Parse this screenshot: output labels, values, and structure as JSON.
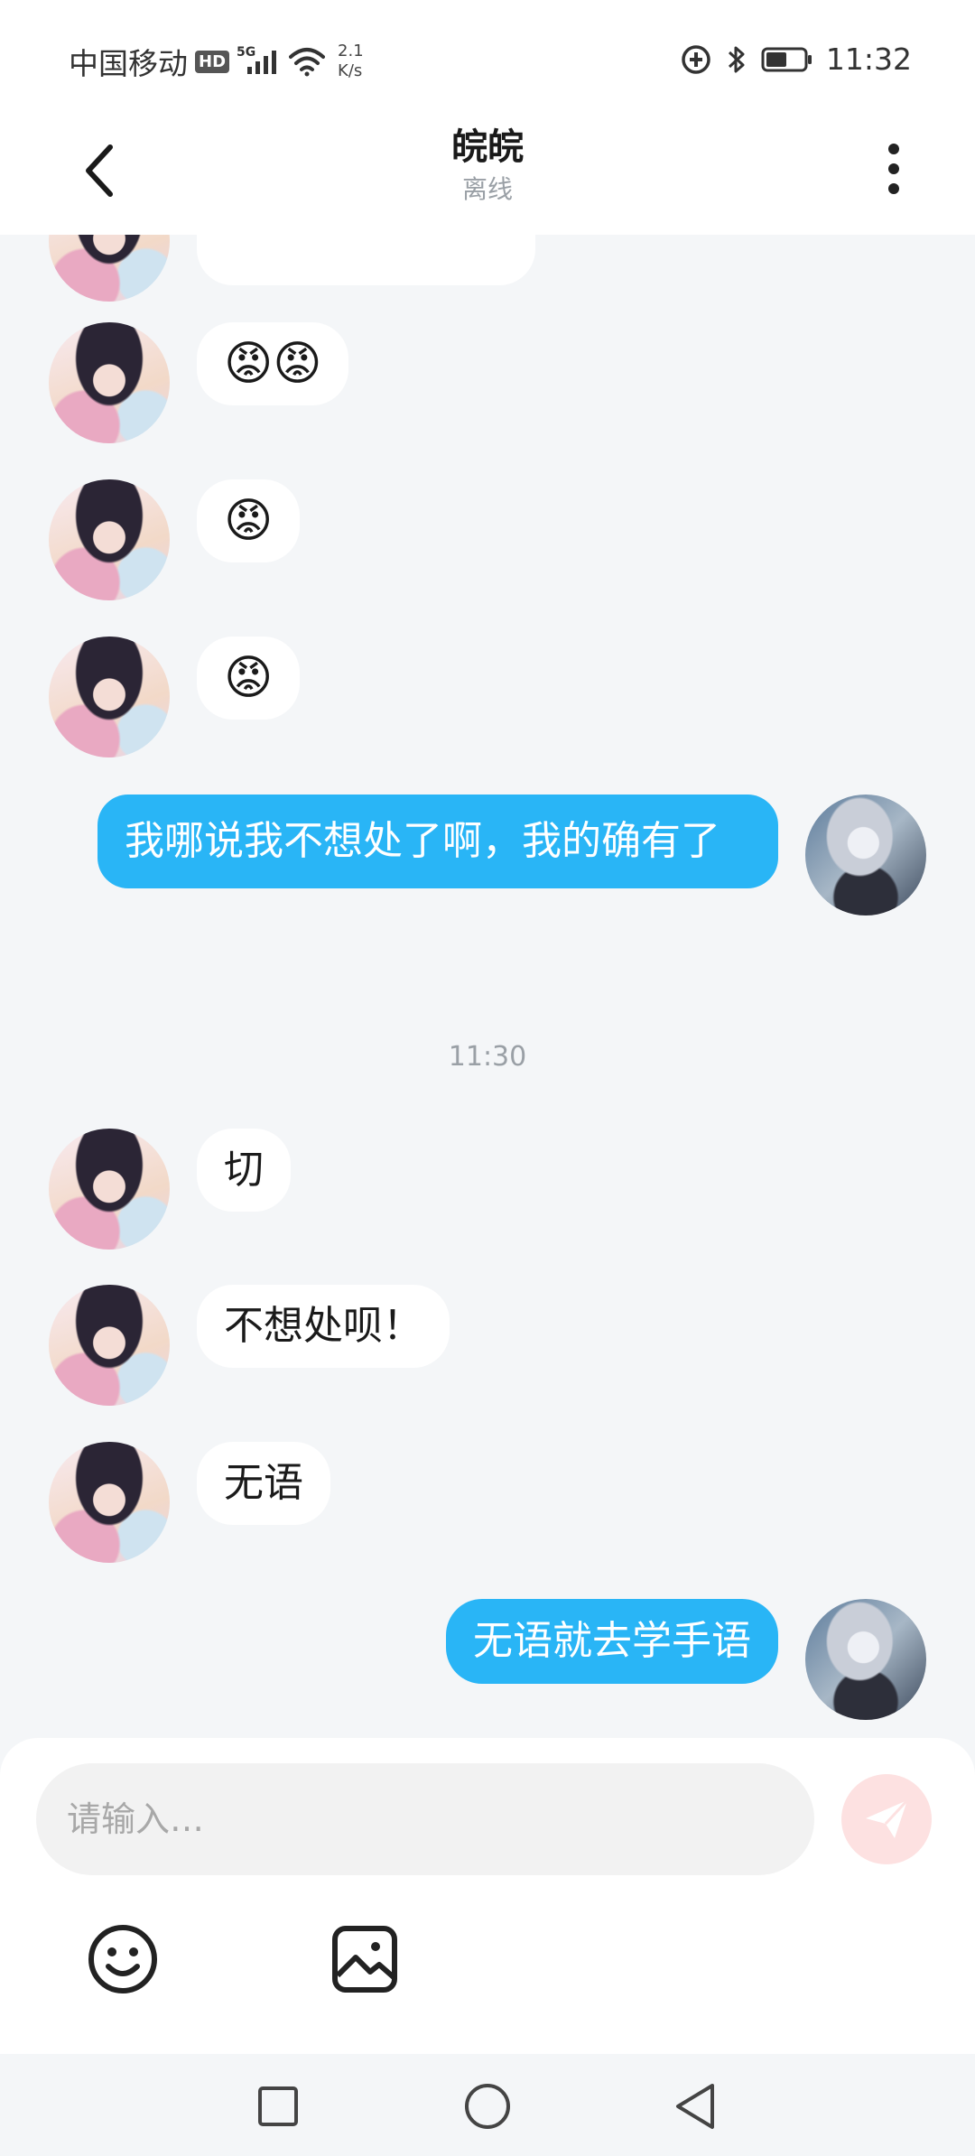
{
  "status_bar": {
    "carrier": "中国移动",
    "hd_label": "HD",
    "network_label": "5G",
    "speed_value": "2.1",
    "speed_unit": "K/s",
    "time": "11:32"
  },
  "header": {
    "title": "皖皖",
    "status": "离线"
  },
  "messages": [
    {
      "sender": "peer",
      "type": "emoji",
      "text": "😡😡"
    },
    {
      "sender": "peer",
      "type": "emoji",
      "text": "😡"
    },
    {
      "sender": "peer",
      "type": "emoji",
      "text": "😡"
    },
    {
      "sender": "self",
      "type": "text",
      "text": "我哪说我不想处了啊，我的确有了"
    },
    {
      "type": "timestamp",
      "text": "11:30"
    },
    {
      "sender": "peer",
      "type": "text",
      "text": "切"
    },
    {
      "sender": "peer",
      "type": "text",
      "text": "不想处呗！"
    },
    {
      "sender": "peer",
      "type": "text",
      "text": "无语"
    },
    {
      "sender": "self",
      "type": "text",
      "text": "无语就去学手语"
    }
  ],
  "input": {
    "placeholder": "请输入…",
    "value": ""
  },
  "icons": {
    "back": "back-arrow-icon",
    "more": "more-vertical-icon",
    "send": "send-icon",
    "emoji": "emoji-smile-icon",
    "image": "image-icon",
    "nav_recents": "square-icon",
    "nav_home": "circle-icon",
    "nav_back": "triangle-back-icon"
  },
  "colors": {
    "self_bubble": "#29b5f6",
    "peer_bubble": "#ffffff",
    "background": "#f4f6f8",
    "send_button": "#fde1e1"
  }
}
